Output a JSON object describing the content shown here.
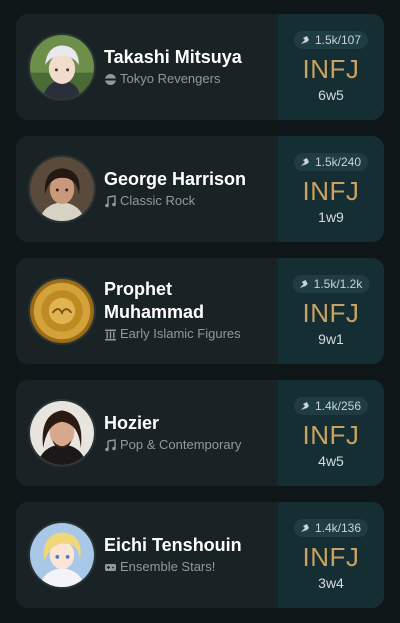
{
  "profiles": [
    {
      "name": "Takashi Mitsuya",
      "category": "Tokyo Revengers",
      "category_icon": "anime-icon",
      "votes": "1.5k/107",
      "type": "INFJ",
      "wing": "6w5"
    },
    {
      "name": "George Harrison",
      "category": "Classic Rock",
      "category_icon": "music-note-icon",
      "votes": "1.5k/240",
      "type": "INFJ",
      "wing": "1w9"
    },
    {
      "name": "Prophet Muhammad",
      "category": "Early Islamic Figures",
      "category_icon": "historical-pillars-icon",
      "votes": "1.5k/1.2k",
      "type": "INFJ",
      "wing": "9w1"
    },
    {
      "name": "Hozier",
      "category": "Pop & Contemporary",
      "category_icon": "music-note-icon",
      "votes": "1.4k/256",
      "type": "INFJ",
      "wing": "4w5"
    },
    {
      "name": "Eichi Tenshouin",
      "category": "Ensemble Stars!",
      "category_icon": "game-icon",
      "votes": "1.4k/136",
      "type": "INFJ",
      "wing": "3w4"
    }
  ],
  "colors": {
    "background": "#0f1617",
    "card": "#192224",
    "type_panel": "#142e33",
    "type_text": "#c9a261"
  }
}
